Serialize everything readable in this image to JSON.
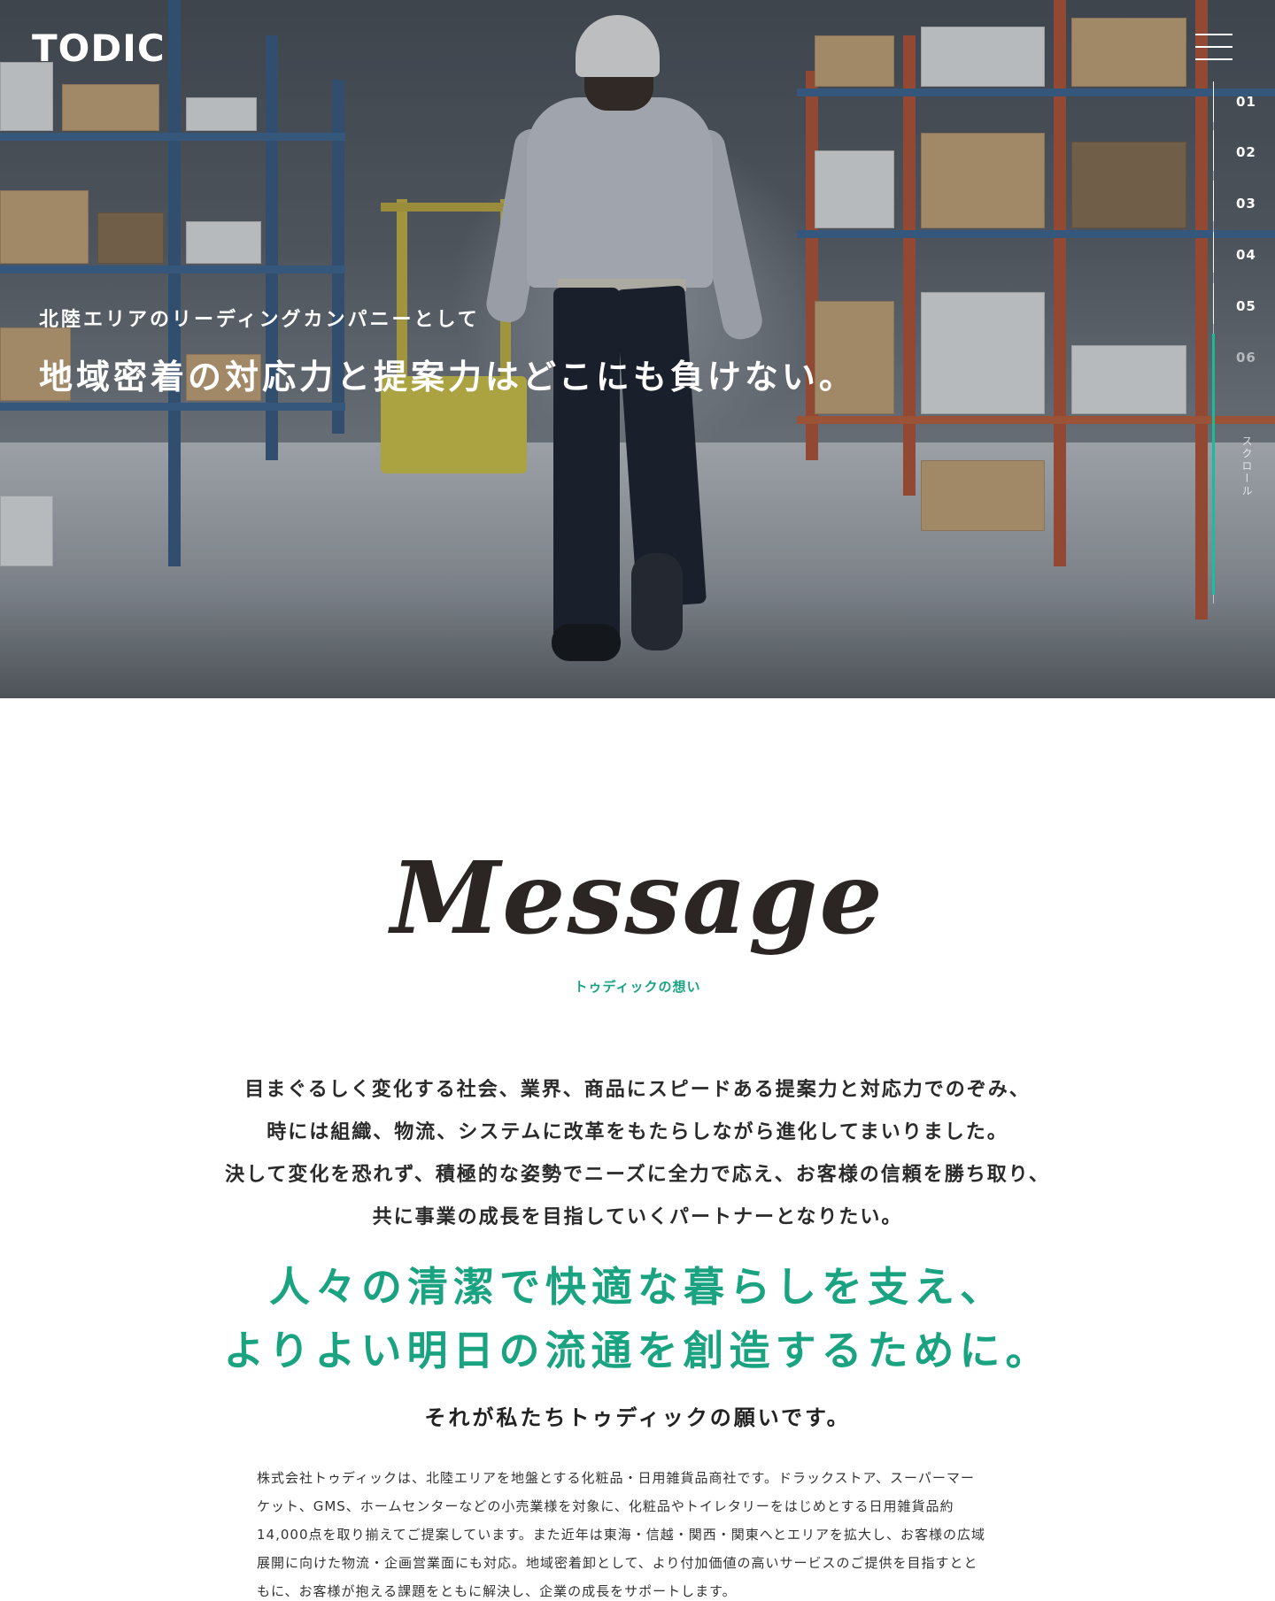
{
  "brand": {
    "logo_text": "TODIC",
    "accent_color": "#1aa380"
  },
  "header": {
    "menu_icon": "hamburger-icon"
  },
  "section_nav": {
    "items": [
      "01",
      "02",
      "03",
      "04",
      "05",
      "06"
    ],
    "active_index": 5,
    "scroll_label": "スクロール"
  },
  "hero": {
    "subtitle": "北陸エリアのリーディングカンパニーとして",
    "title": "地域密着の対応力と提案力はどこにも負けない。"
  },
  "message": {
    "heading": "Message",
    "subheading": "トゥディックの想い",
    "lead": [
      "目まぐるしく変化する社会、業界、商品にスピードある提案力と対応力でのぞみ、",
      "時には組織、物流、システムに改革をもたらしながら進化してまいりました。",
      "決して変化を恐れず、積極的な姿勢でニーズに全力で応え、お客様の信頼を勝ち取り、",
      "共に事業の成長を目指していくパートナーとなりたい。"
    ],
    "catch": [
      "人々の清潔で快適な暮らしを支え、",
      "よりよい明日の流通を創造するために。"
    ],
    "catch_sub": "それが私たちトゥディックの願いです。",
    "body": [
      "株式会社トゥディックは、北陸エリアを地盤とする化粧品・日用雑貨品商社です。ドラックストア、スーパーマー",
      "ケット、GMS、ホームセンターなどの小売業様を対象に、化粧品やトイレタリーをはじめとする日用雑貨品約",
      "14,000点を取り揃えてご提案しています。また近年は東海・信越・関西・関東へとエリアを拡大し、お客様の広域",
      "展開に向けた物流・企画営業面にも対応。地域密着卸として、より付加価値の高いサービスのご提供を目指すとと",
      "もに、お客様が抱える課題をともに解決し、企業の成長をサポートします。"
    ]
  }
}
